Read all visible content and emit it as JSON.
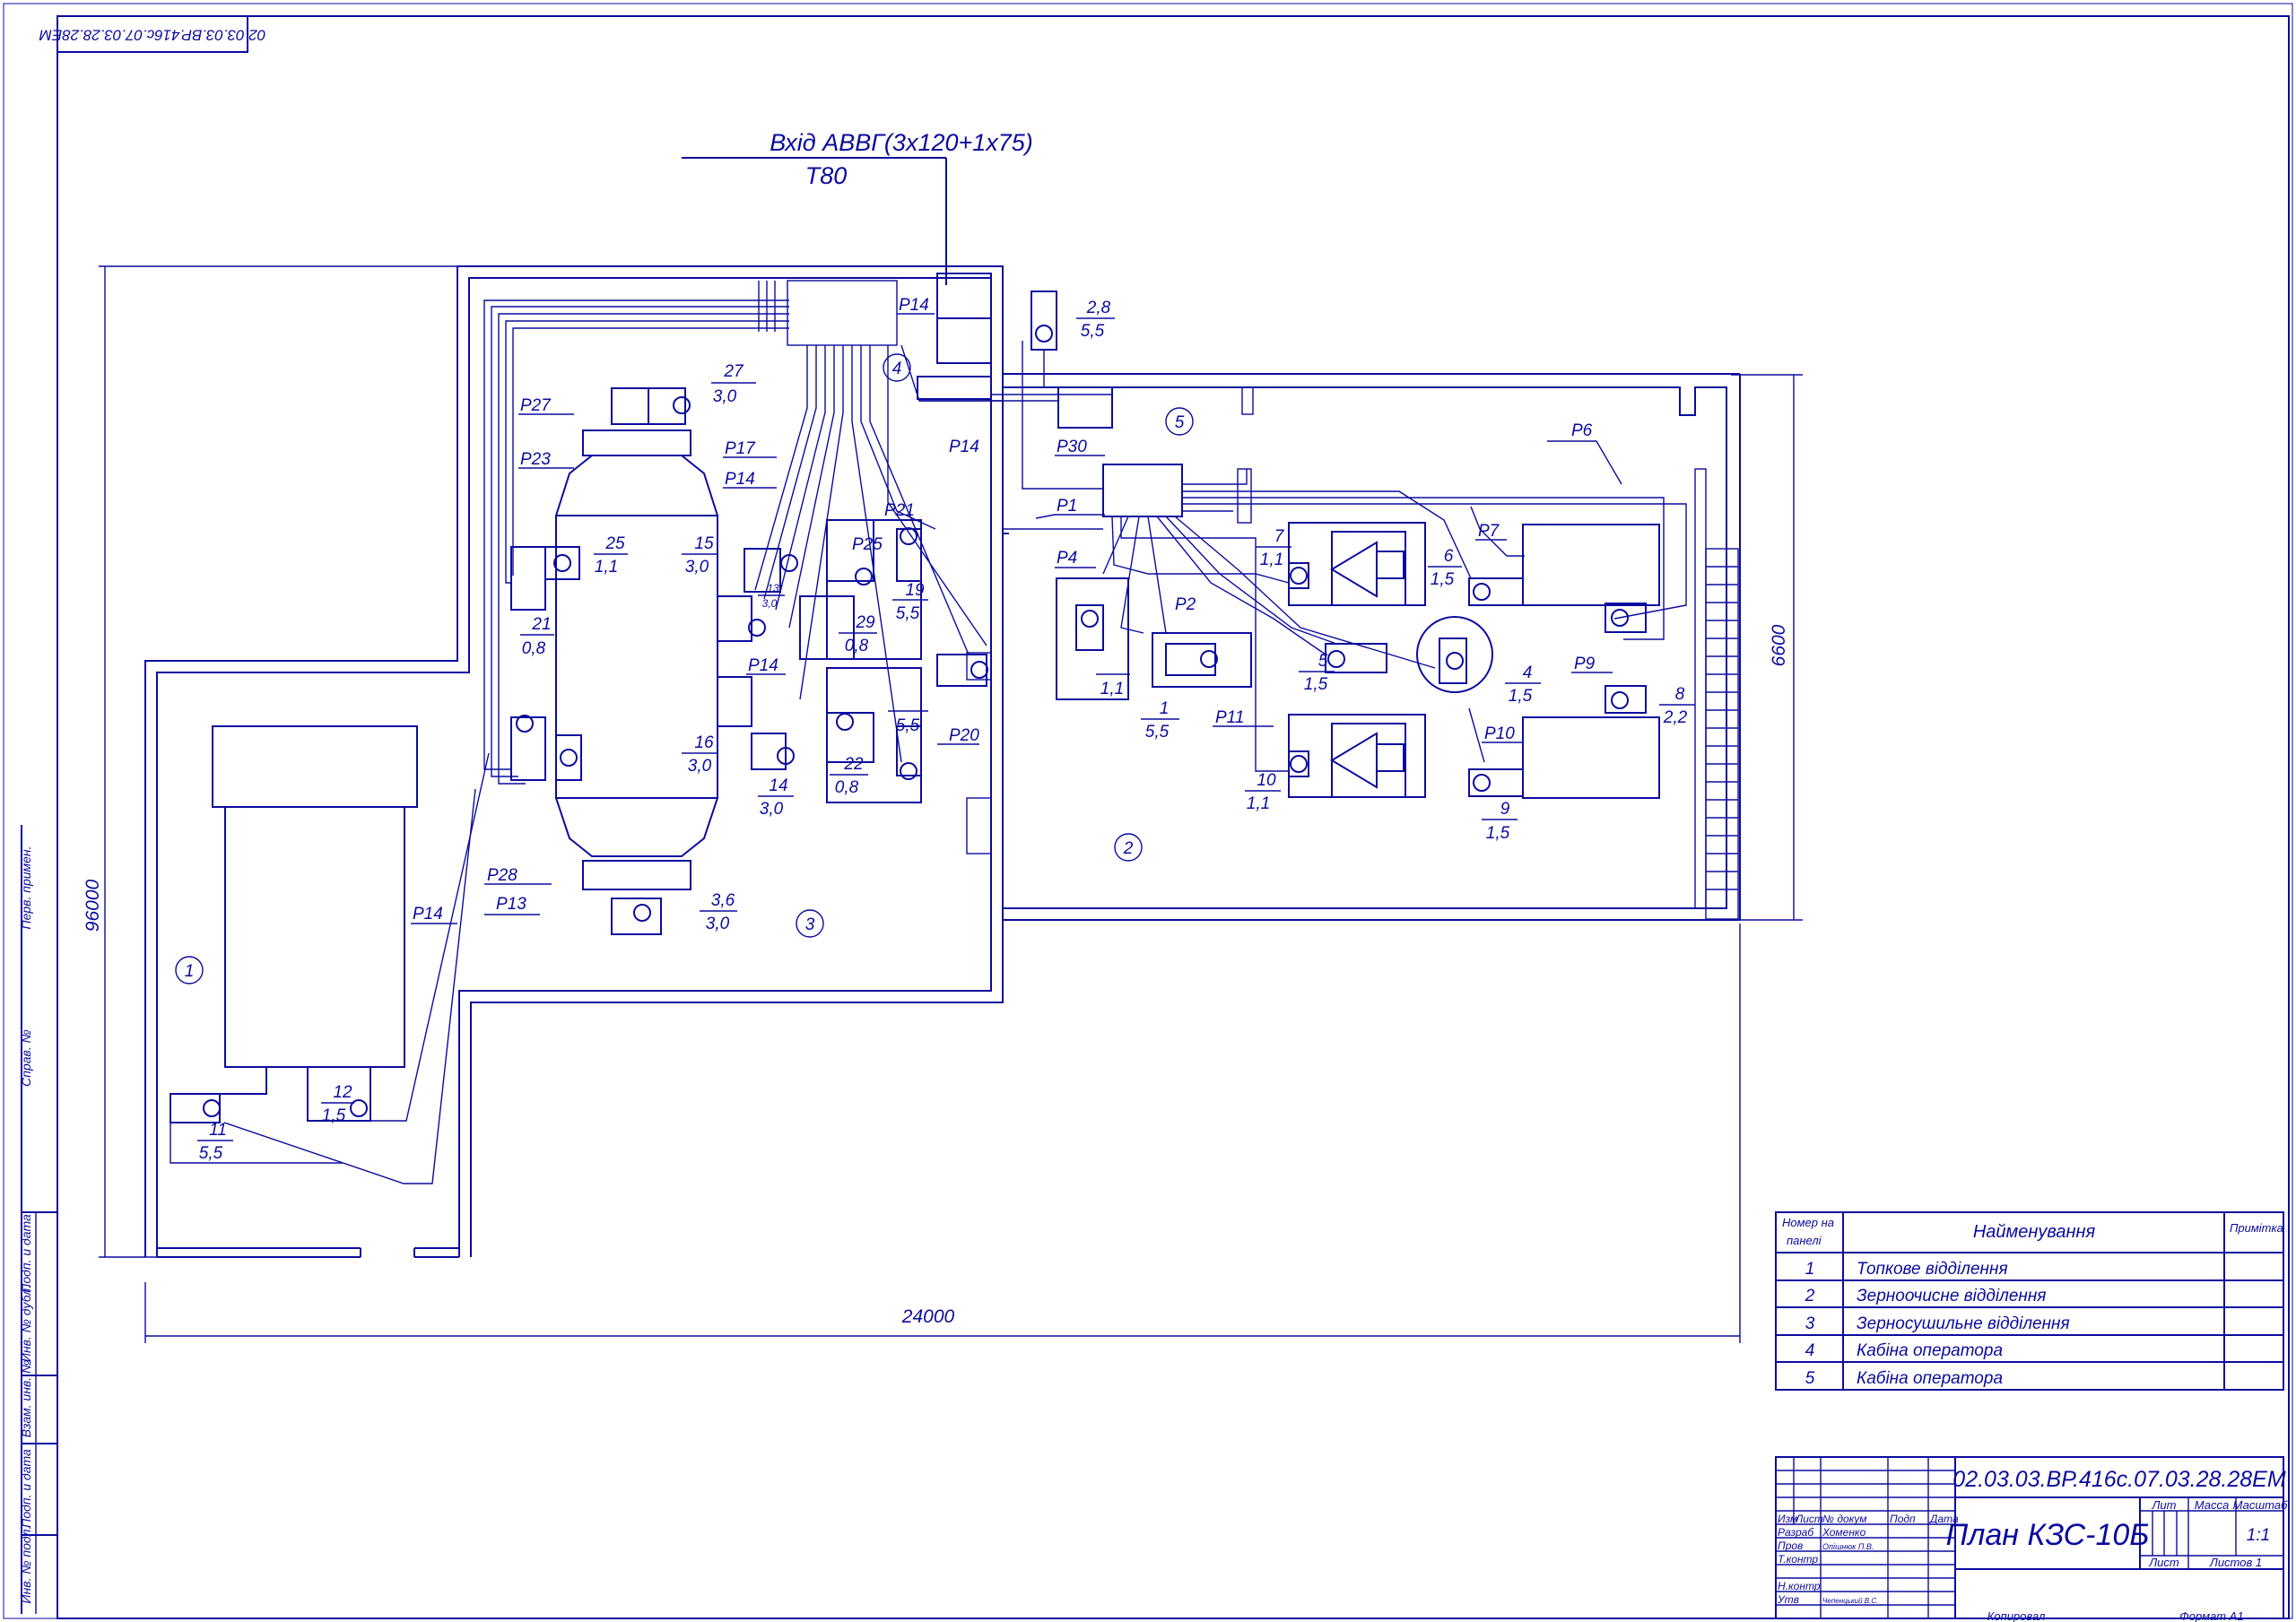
{
  "doc_code_stamp": "02.03.03.ВР.416с.07.03.28.28ЕМ",
  "doc_code": "02.03.03.ВР.416с.07.03.28.28ЕМ",
  "title": "План КЗС-10Б",
  "input": {
    "line1": "Вхід АВВГ(3х120+1х75)",
    "line2": "Т80"
  },
  "dims": {
    "width": "24000",
    "height": "96000",
    "side": "6600"
  },
  "zones": [
    {
      "num": "1",
      "name": "Топкове відділення"
    },
    {
      "num": "2",
      "name": "Зерноочисне відділення"
    },
    {
      "num": "3",
      "name": "Зерносушильне відділення"
    },
    {
      "num": "4",
      "name": "Кабіна оператора"
    },
    {
      "num": "5",
      "name": "Кабіна оператора"
    }
  ],
  "table": {
    "col1": "Номер на панелі",
    "col1a": "Номер на",
    "col1b": "панелі",
    "col2": "Найменування",
    "col3": "Примітка"
  },
  "cables": [
    "Р14",
    "Р27",
    "Р23",
    "Р17",
    "Р14",
    "Р21",
    "Р25",
    "Р14",
    "Р20",
    "Р28",
    "Р13",
    "Р14",
    "Р30",
    "Р1",
    "Р4",
    "Р2",
    "Р6",
    "Р7",
    "Р9",
    "Р10",
    "Р11",
    "Р14"
  ],
  "motors": [
    {
      "num": "27",
      "kw": "3,0"
    },
    {
      "num": "25",
      "kw": "1,1"
    },
    {
      "num": "15",
      "kw": "3,0"
    },
    {
      "num": "13",
      "kw": "3,0"
    },
    {
      "num": "19",
      "kw": "5,5"
    },
    {
      "num": "29",
      "kw": "0,8"
    },
    {
      "num": "21",
      "kw": "0,8"
    },
    {
      "num": "5,5",
      "kw": ""
    },
    {
      "num": "16",
      "kw": "3,0"
    },
    {
      "num": "14",
      "kw": "3,0"
    },
    {
      "num": "22",
      "kw": "0,8"
    },
    {
      "num": "3,6",
      "kw": "3,0"
    },
    {
      "num": "12",
      "kw": "1,5"
    },
    {
      "num": "11",
      "kw": "5,5"
    },
    {
      "num": "2,8",
      "kw": "5,5"
    },
    {
      "num": "7",
      "kw": "1,1"
    },
    {
      "num": "6",
      "kw": "1,5"
    },
    {
      "num": "1",
      "kw": "5,5"
    },
    {
      "num": "",
      "kw": "1,1"
    },
    {
      "num": "5",
      "kw": "1,5"
    },
    {
      "num": "4",
      "kw": "1,5"
    },
    {
      "num": "8",
      "kw": "2,2"
    },
    {
      "num": "10",
      "kw": "1,1"
    },
    {
      "num": "9",
      "kw": "1,5"
    }
  ],
  "stamp": {
    "lit": "Лит",
    "mass": "Масса",
    "scale_h": "Масштаб",
    "scale": "1:1",
    "sheet": "Лист",
    "sheets": "Листов 1",
    "izm": "Изм",
    "list": "Лист",
    "doc": "№ докум",
    "sign": "Подп",
    "date": "Дата",
    "razrab": "Разраб",
    "razrab_name": "Хоменко",
    "prov": "Пров",
    "prov_name": "Опішнюк П.В.",
    "tkontr": "Т.контр",
    "nkontr": "Н.контр",
    "utv": "Утв",
    "utv_name": "Чепенцький В.С.",
    "kopir": "Копировал",
    "format": "Формат А1"
  },
  "side_labels": [
    "Перв. примен.",
    "Справ. №",
    "Подп. и дата",
    "Инв. № дубл.",
    "Взам. инв. №",
    "Подп. и дата",
    "Инв. № подл."
  ]
}
